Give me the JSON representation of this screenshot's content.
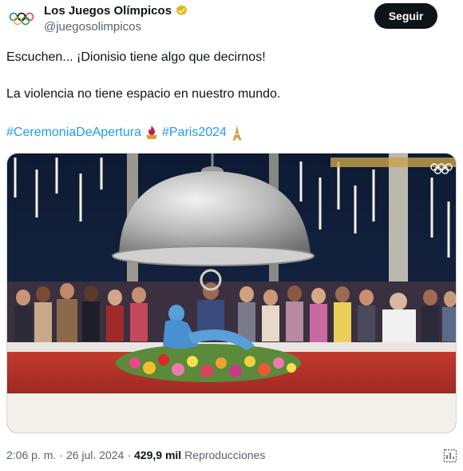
{
  "account": {
    "display_name": "Los Juegos Olímpicos",
    "handle": "@juegosolimpicos",
    "verified_badge": "gold-verified-badge",
    "follow_label": "Seguir"
  },
  "post": {
    "line1": "Escuchen... ¡Dionisio tiene algo que decirnos!",
    "line2": "La violencia no tiene espacio en nuestro mundo.",
    "hashtag1": "#CeremoniaDeApertura",
    "hashtag2": "#Paris2024"
  },
  "meta": {
    "time": "2:06 p. m.",
    "sep1": "·",
    "date": "26 jul. 2024",
    "sep2": "·",
    "views_count": "429,9 mil",
    "views_label": "Reproducciones"
  },
  "colors": {
    "link": "#1d9bf0",
    "text": "#0f1419",
    "muted": "#536471",
    "button": "#0f1419"
  },
  "icons": [
    "olympic-rings-icon",
    "verified-badge-icon",
    "flame-emoji-icon",
    "eiffel-tower-emoji-icon",
    "stats-icon"
  ]
}
